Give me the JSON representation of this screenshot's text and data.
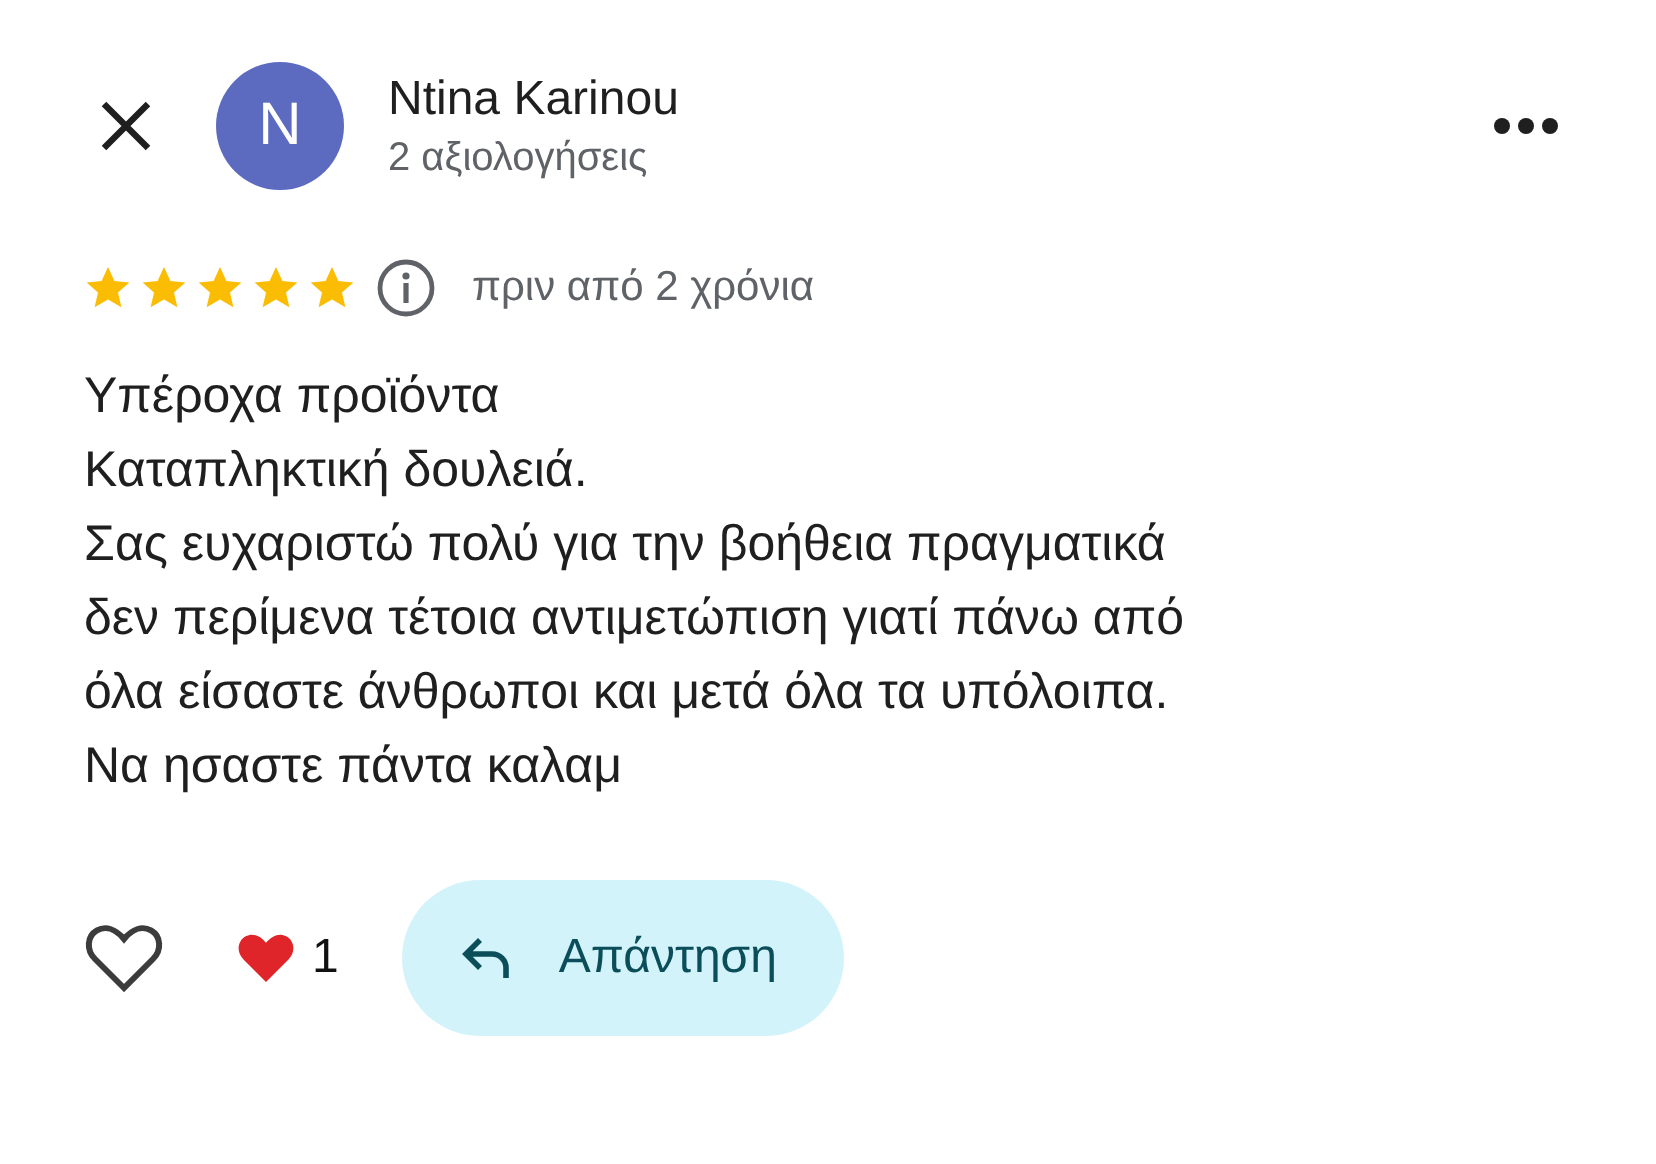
{
  "reviewer": {
    "name": "Ntina Karinou",
    "initial": "N",
    "reviews_count": "2 αξιολογήσεις"
  },
  "rating": {
    "stars": 5,
    "time": "πριν από 2 χρόνια"
  },
  "body_lines": [
    "Υπέροχα προϊόντα",
    "Καταπληκτική δουλειά.",
    "Σας ευχαριστώ πολύ για την βοήθεια πραγματικά",
    "δεν περίμενα τέτοια αντιμετώπιση γιατί πάνω από",
    "όλα είσαστε άνθρωποι και μετά όλα τα υπόλοιπα.",
    "Να ησαστε πάντα καλαμ"
  ],
  "actions": {
    "liked": false,
    "reaction_count": "1",
    "reply_label": "Απάντηση"
  }
}
